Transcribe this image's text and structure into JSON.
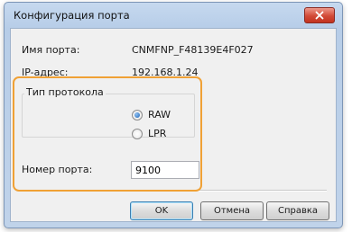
{
  "window": {
    "title": "Конфигурация порта"
  },
  "fields": {
    "port_name_label": "Имя порта:",
    "port_name_value": "CNMFNP_F48139E4F027",
    "ip_label": "IP-адрес:",
    "ip_value": "192.168.1.24"
  },
  "protocol": {
    "group_label": "Тип протокола",
    "options": [
      {
        "label": "RAW",
        "selected": true
      },
      {
        "label": "LPR",
        "selected": false
      }
    ]
  },
  "port_number": {
    "label": "Номер порта:",
    "value": "9100"
  },
  "buttons": {
    "ok": "OK",
    "cancel": "Отмена",
    "help": "Справка"
  },
  "colors": {
    "highlight": "#f0a135",
    "close_button": "#d24a37"
  }
}
